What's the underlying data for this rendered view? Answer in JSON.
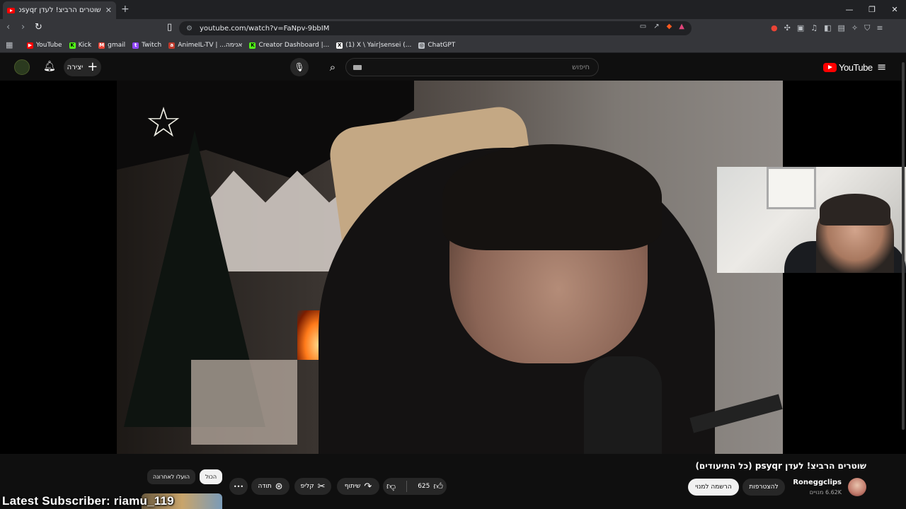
{
  "browser": {
    "tab_title": "שוטרים הרביצ! לעדן psyqr (כל ה",
    "tab_close": "✕",
    "new_tab": "+",
    "url": "youtube.com/watch?v=FaNpv-9bbIM",
    "window_controls": [
      "—",
      "❐",
      "✕"
    ],
    "bookmarks": [
      {
        "label": "YouTube",
        "icon": "youtube-icon",
        "color": "#ff0000",
        "glyph": "▶"
      },
      {
        "label": "Kick",
        "icon": "kick-icon",
        "color": "#53fc18",
        "glyph": "K"
      },
      {
        "label": "gmail",
        "icon": "gmail-icon",
        "color": "#ea4335",
        "glyph": "M"
      },
      {
        "label": "Twitch",
        "icon": "twitch-icon",
        "color": "#9146ff",
        "glyph": "t"
      },
      {
        "label": "AnimeIL-TV | ...אנימה",
        "icon": "animeil-icon",
        "color": "#c0392b",
        "glyph": "a"
      },
      {
        "label": "Creator Dashboard |...",
        "icon": "kick-creator-icon",
        "color": "#53fc18",
        "glyph": "K"
      },
      {
        "label": "(1) X \\ Yair|sensei (...",
        "icon": "x-icon",
        "color": "#ffffff",
        "glyph": "X"
      },
      {
        "label": "ChatGPT",
        "icon": "chatgpt-icon",
        "color": "#bdc1c6",
        "glyph": "◎"
      }
    ]
  },
  "youtube": {
    "create_label": "יצירה",
    "search_placeholder": "חיפוש",
    "logo_text": "YouTube",
    "video": {
      "title": "שוטרים הרביצ! לעדן psyqr (כל התיעודים)",
      "channel_name": "Roneggclips",
      "channel_subs": "6.62K מנויים",
      "join_label": "להצטרפות",
      "subscribe_label": "הרשמה למנוי",
      "like_count": "625",
      "share_label": "שיתוף",
      "clip_label": "קליפ",
      "thanks_label": "תודה",
      "more_label": "•••"
    },
    "chips": [
      "הכול",
      "הועלו לאחרונה"
    ],
    "chips_active_index": 0
  },
  "overlay": {
    "text": "Latest Subscriber: riamu_119"
  },
  "colors": {
    "brand": "#ff0000",
    "background": "#0f0f0f",
    "pill": "#272727"
  }
}
